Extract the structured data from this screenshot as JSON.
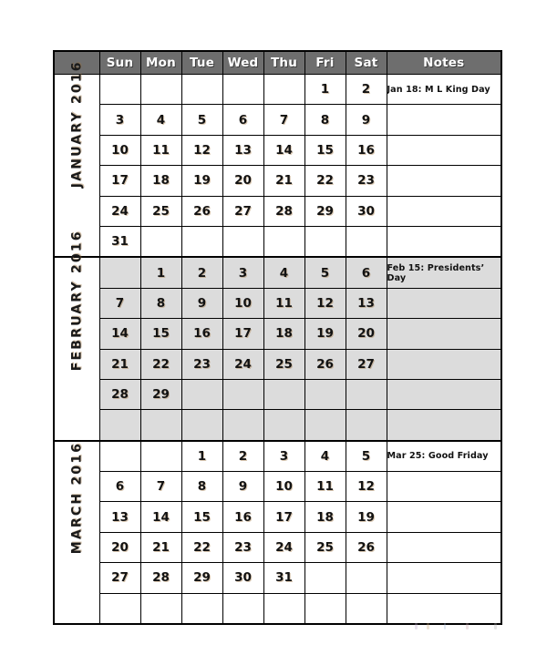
{
  "document": {
    "title": "2016 Quarterly Calendar - Q1",
    "background_color": "#ffffff"
  },
  "colors": {
    "header_background": "#6e6e6e",
    "header_text": "#ffffff",
    "shaded_row_background": "#dcdcdc",
    "cell_background": "#ffffff",
    "border": "#000000",
    "text": "#121212"
  },
  "table": {
    "columns": [
      {
        "key": "month",
        "label": ""
      },
      {
        "key": "sun",
        "label": "Sun"
      },
      {
        "key": "mon",
        "label": "Mon"
      },
      {
        "key": "tue",
        "label": "Tue"
      },
      {
        "key": "wed",
        "label": "Wed"
      },
      {
        "key": "thu",
        "label": "Thu"
      },
      {
        "key": "fri",
        "label": "Fri"
      },
      {
        "key": "sat",
        "label": "Sat"
      },
      {
        "key": "notes",
        "label": "Notes"
      }
    ],
    "header": {
      "corner": "",
      "sun": "Sun",
      "mon": "Mon",
      "tue": "Tue",
      "wed": "Wed",
      "thu": "Thu",
      "fri": "Fri",
      "sat": "Sat",
      "notes": "Notes"
    }
  },
  "months": [
    {
      "id": "january",
      "label": "JANUARY 2016",
      "shaded": false,
      "weeks": [
        {
          "days": [
            "",
            "",
            "",
            "",
            "",
            "1",
            "2"
          ],
          "note": "Jan 18: M L King Day"
        },
        {
          "days": [
            "3",
            "4",
            "5",
            "6",
            "7",
            "8",
            "9"
          ],
          "note": ""
        },
        {
          "days": [
            "10",
            "11",
            "12",
            "13",
            "14",
            "15",
            "16"
          ],
          "note": ""
        },
        {
          "days": [
            "17",
            "18",
            "19",
            "20",
            "21",
            "22",
            "23"
          ],
          "note": ""
        },
        {
          "days": [
            "24",
            "25",
            "26",
            "27",
            "28",
            "29",
            "30"
          ],
          "note": ""
        },
        {
          "days": [
            "31",
            "",
            "",
            "",
            "",
            "",
            ""
          ],
          "note": ""
        }
      ]
    },
    {
      "id": "february",
      "label": "FEBRUARY 2016",
      "shaded": true,
      "weeks": [
        {
          "days": [
            "",
            "1",
            "2",
            "3",
            "4",
            "5",
            "6"
          ],
          "note": "Feb 15: Presidents’ Day"
        },
        {
          "days": [
            "7",
            "8",
            "9",
            "10",
            "11",
            "12",
            "13"
          ],
          "note": ""
        },
        {
          "days": [
            "14",
            "15",
            "16",
            "17",
            "18",
            "19",
            "20"
          ],
          "note": ""
        },
        {
          "days": [
            "21",
            "22",
            "23",
            "24",
            "25",
            "26",
            "27"
          ],
          "note": ""
        },
        {
          "days": [
            "28",
            "29",
            "",
            "",
            "",
            "",
            ""
          ],
          "note": ""
        },
        {
          "days": [
            "",
            "",
            "",
            "",
            "",
            "",
            ""
          ],
          "note": ""
        }
      ]
    },
    {
      "id": "march",
      "label": "MARCH 2016",
      "shaded": false,
      "weeks": [
        {
          "days": [
            "",
            "",
            "1",
            "2",
            "3",
            "4",
            "5"
          ],
          "note": "Mar 25: Good Friday"
        },
        {
          "days": [
            "6",
            "7",
            "8",
            "9",
            "10",
            "11",
            "12"
          ],
          "note": ""
        },
        {
          "days": [
            "13",
            "14",
            "15",
            "16",
            "17",
            "18",
            "19"
          ],
          "note": ""
        },
        {
          "days": [
            "20",
            "21",
            "22",
            "23",
            "24",
            "25",
            "26"
          ],
          "note": ""
        },
        {
          "days": [
            "27",
            "28",
            "29",
            "30",
            "31",
            "",
            ""
          ],
          "note": ""
        },
        {
          "days": [
            "",
            "",
            "",
            "",
            "",
            "",
            ""
          ],
          "note": ""
        }
      ]
    }
  ],
  "footer": {
    "marks": [
      "#b9a2c8",
      "#c9a87a",
      "#9fb4d6",
      "#c8a0a8",
      "#b0b0b0"
    ]
  }
}
